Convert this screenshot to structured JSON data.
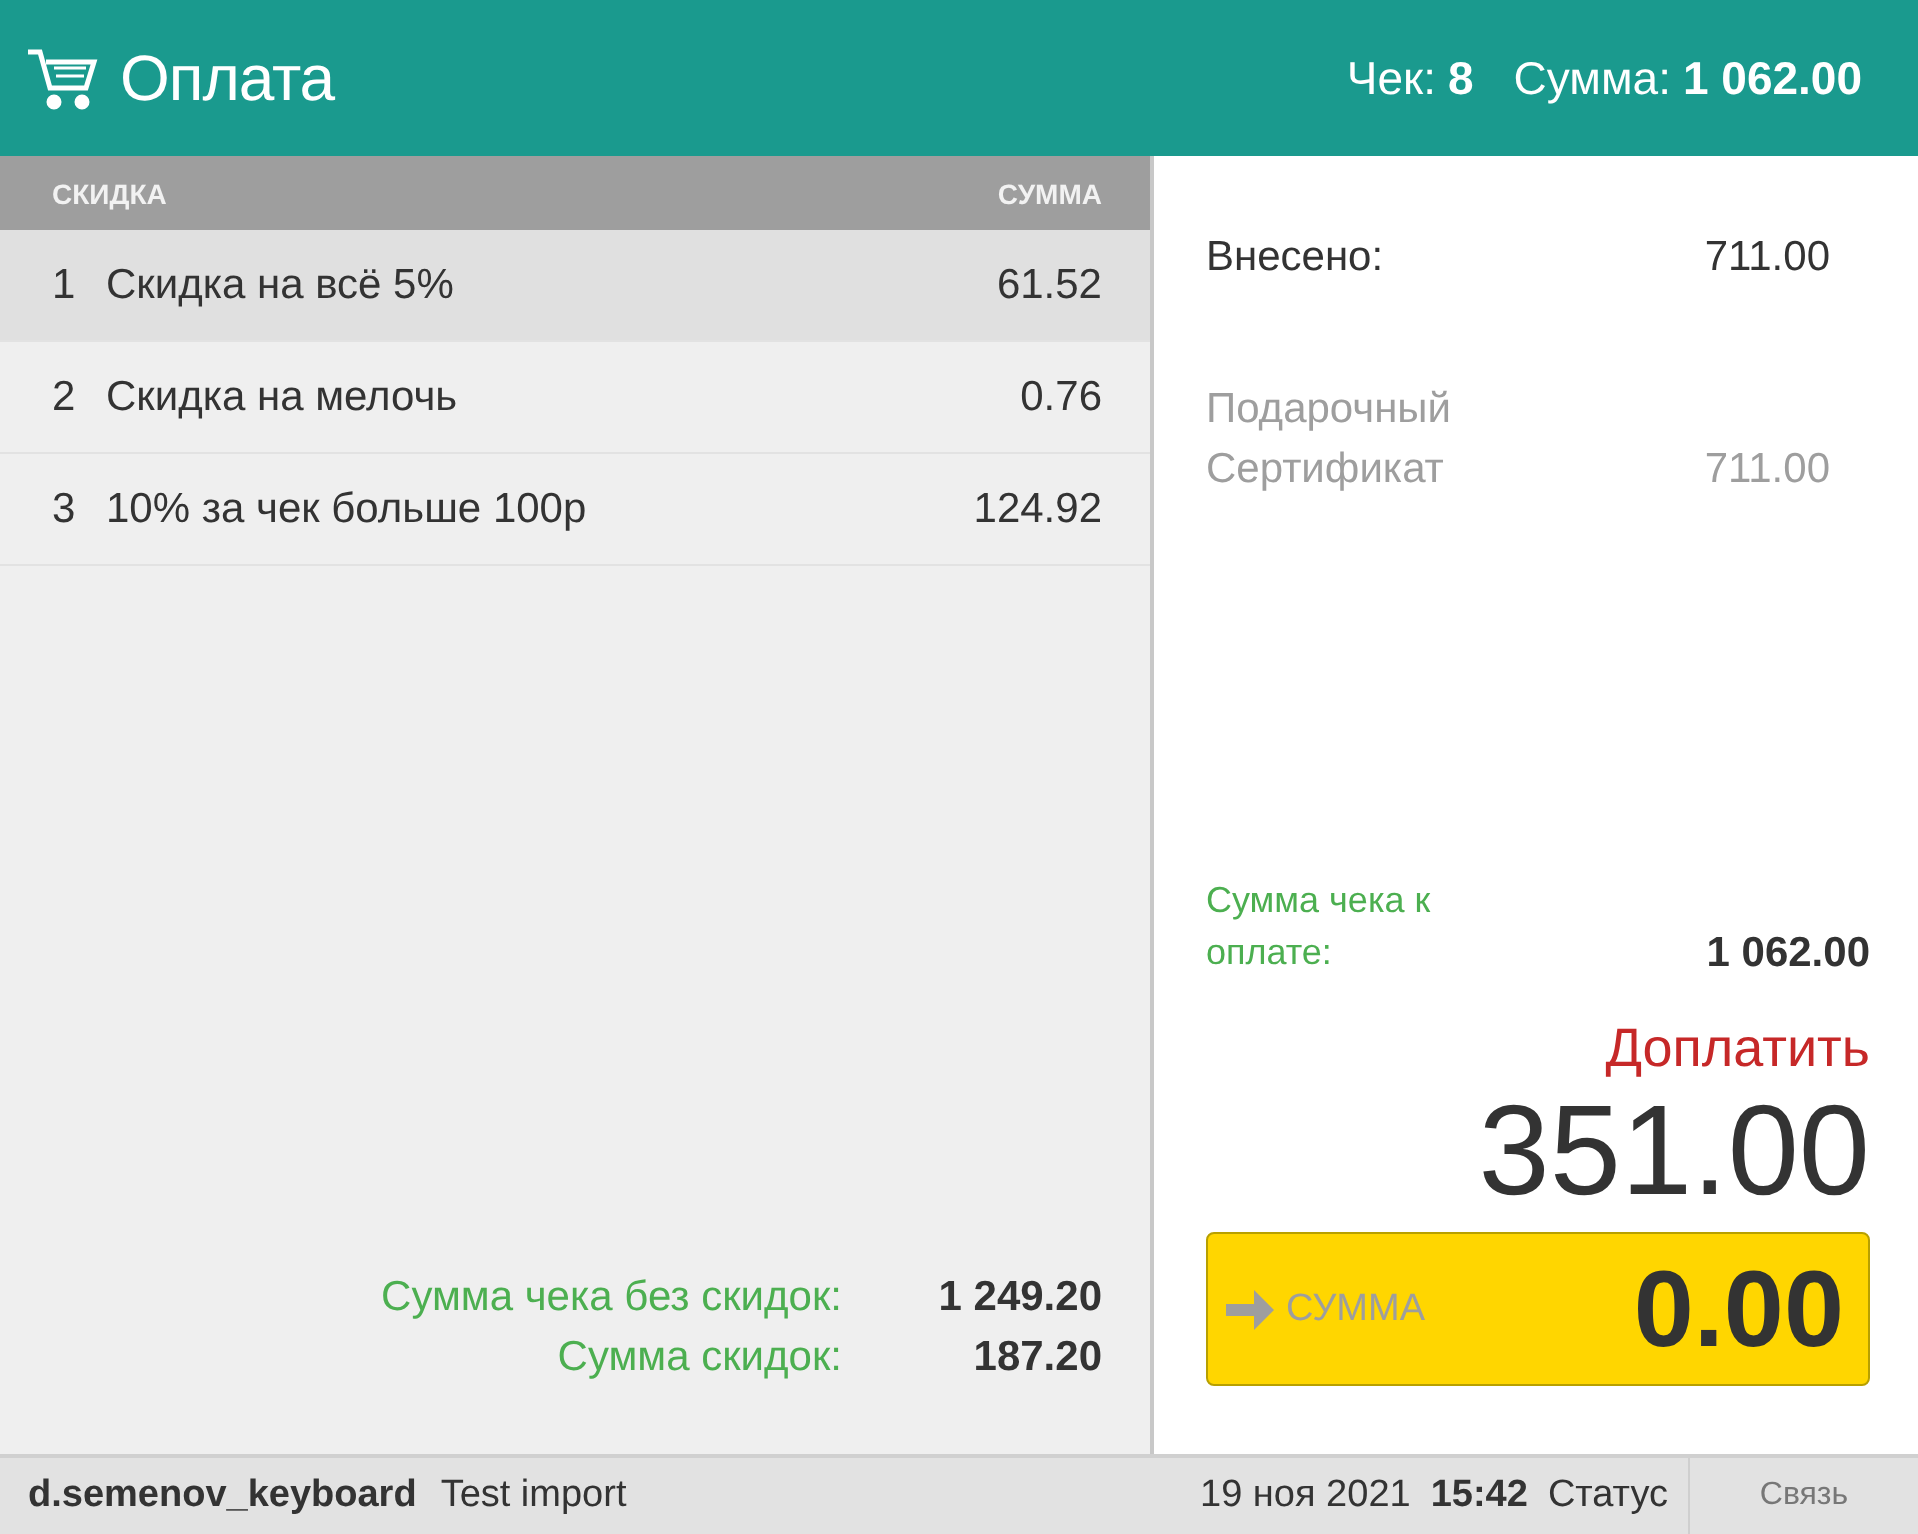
{
  "header": {
    "title": "Оплата",
    "receipt_label": "Чек:",
    "receipt_number": "8",
    "sum_label": "Сумма:",
    "sum_value": "1 062.00"
  },
  "discounts": {
    "columns": [
      "СКИДКА",
      "СУММА"
    ],
    "rows": [
      {
        "number": "1",
        "name": "Скидка на всё 5%",
        "amount": "61.52",
        "selected": true
      },
      {
        "number": "2",
        "name": "Скидка на мелочь",
        "amount": "0.76",
        "selected": false
      },
      {
        "number": "3",
        "name": "10% за чек больше 100р",
        "amount": "124.92",
        "selected": false
      }
    ],
    "totals": [
      {
        "label": "Сумма чека без скидок:",
        "value": "1 249.20"
      },
      {
        "label": "Сумма скидок:",
        "value": "187.20"
      }
    ]
  },
  "payment": {
    "entries": [
      {
        "kind": "total",
        "label": "Внесено:",
        "value": "711.00"
      },
      {
        "kind": "method",
        "label": "Подарочный Сертификат",
        "value": "711.00"
      }
    ],
    "due_label": "Сумма чека к оплате:",
    "due_value": "1 062.00",
    "remaining_label": "Доплатить",
    "remaining_value": "351.00",
    "input": {
      "placeholder": "СУММА",
      "value": "0.00"
    }
  },
  "status_bar": {
    "user": "d.semenov_keyboard",
    "store": "Test import",
    "date": "19 ноя 2021",
    "time": "15:42",
    "status": "Статус",
    "connection": "Связь"
  }
}
